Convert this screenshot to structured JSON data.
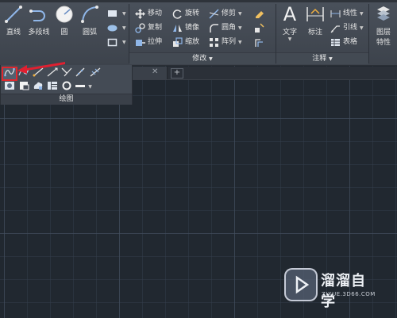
{
  "ribbon": {
    "draw_panel": {
      "line_label": "直线",
      "polyline_label": "多段线",
      "circle_label": "圆",
      "arc_label": "圆弧"
    },
    "modify_panel": {
      "title": "修改",
      "move_label": "移动",
      "rotate_label": "旋转",
      "trim_label": "修剪",
      "copy_label": "复制",
      "mirror_label": "镜像",
      "fillet_label": "圆角",
      "stretch_label": "拉伸",
      "scale_label": "缩放",
      "array_label": "阵列"
    },
    "annotation_panel": {
      "title": "注释",
      "text_label": "文字",
      "dimension_label": "标注",
      "linear_label": "线性",
      "leader_label": "引线",
      "table_label": "表格"
    },
    "layers_panel": {
      "layer_properties_label_1": "图层",
      "layer_properties_label_2": "特性"
    }
  },
  "draw_flyout": {
    "title": "绘图"
  },
  "watermark": {
    "name": "溜溜自学",
    "url": "ZIXUE.3D66.COM"
  },
  "colors": {
    "canvas": "#212830",
    "ribbon": "#444b55",
    "highlight": "#e0282e",
    "arrow": "#e02030"
  }
}
